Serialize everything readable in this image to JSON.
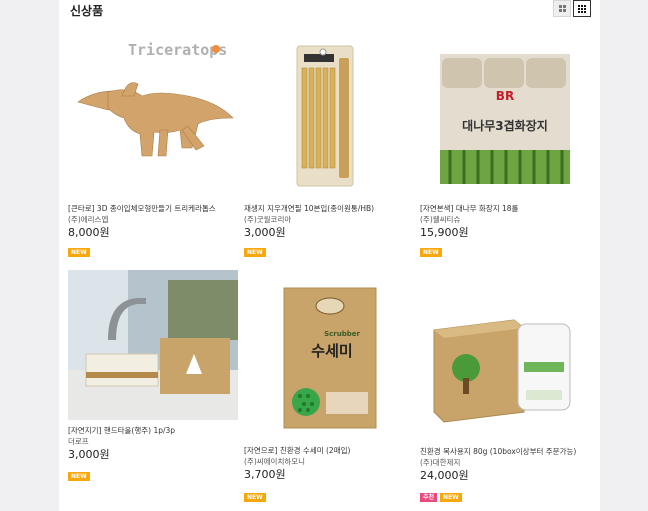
{
  "section_title": "신상품",
  "view_icons": [
    "grid-2-icon",
    "grid-3-icon"
  ],
  "colors": {
    "new_badge": "#f7a70a",
    "recommend_badge": "#e94a7c"
  },
  "products": [
    {
      "name": "[큰타로] 3D 종이입체모형만들기 트리케라톱스",
      "maker": "(주)에리스엡",
      "price": "8,000원",
      "badges": [
        "NEW"
      ],
      "image_text": "Triceratops"
    },
    {
      "name": "재생지 지우개연필 10본입(종이원통/HB)",
      "maker": "(주)굿월코리아",
      "price": "3,000원",
      "badges": [
        "NEW"
      ]
    },
    {
      "name": "[자연본색] 대나무 화장지 18롤",
      "maker": "(주)웰씨티슈",
      "price": "15,900원",
      "badges": [
        "NEW"
      ],
      "image_text": "대나무3겹화장지"
    },
    {
      "name": "[자연지기] 핸드타올(행주) 1p/3p",
      "maker": "더로프",
      "price": "3,000원",
      "badges": [
        "NEW"
      ]
    },
    {
      "name": "[자연으로] 친환경 수세미 (2매입)",
      "maker": "(주)씨에이치하모니",
      "price": "3,700원",
      "badges": [
        "NEW"
      ],
      "image_text": "수세미"
    },
    {
      "name": "친환경 복사용지 80g (10box이상부터 주문가능)",
      "maker": "(주)대한제지",
      "price": "24,000원",
      "badges": [
        "추천",
        "NEW"
      ]
    }
  ]
}
